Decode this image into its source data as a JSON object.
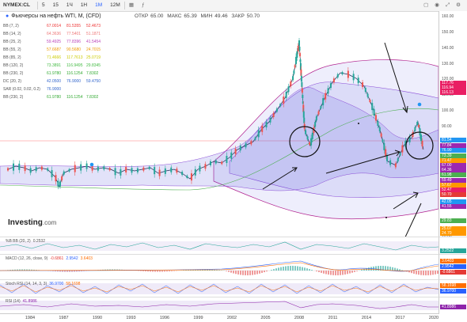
{
  "toolbar": {
    "symbol": "NYMEX:CL",
    "intervals": [
      "5",
      "15",
      "1Ч",
      "1Н",
      "1М",
      "12М"
    ],
    "active_interval": "1М",
    "icons": [
      "candles-icon",
      "indicators-icon",
      "layout-icon",
      "camera-icon",
      "fullscreen-icon",
      "settings-icon"
    ]
  },
  "header": {
    "title": "Фьючерсы на нефть WTI, M, (CFD)",
    "ohlc": [
      {
        "label": "ОТКР",
        "value": "65.00"
      },
      {
        "label": "МАКС",
        "value": "65.39"
      },
      {
        "label": "МИН",
        "value": "49.46"
      },
      {
        "label": "ЗАКР",
        "value": "50.70"
      }
    ]
  },
  "indicators": [
    {
      "name": "BB (7, 2)",
      "v1": "67.0014",
      "v2": "81.5355",
      "v3": "52.4673",
      "color": "#e33"
    },
    {
      "name": "BB (14, 2)",
      "v1": "64.3636",
      "v2": "77.5401",
      "v3": "51.1871",
      "color": "#e77"
    },
    {
      "name": "BB (25, 2)",
      "v1": "59.4925",
      "v2": "77.8396",
      "v3": "41.5454",
      "color": "#b4b"
    },
    {
      "name": "BB (55, 2)",
      "v1": "57.6687",
      "v2": "90.5680",
      "v3": "24.7015",
      "color": "#e90"
    },
    {
      "name": "BB (85, 2)",
      "v1": "71.4666",
      "v2": "117.7613",
      "v3": "25.0719",
      "color": "#cc0"
    },
    {
      "name": "BB (120, 2)",
      "v1": "73.3891",
      "v2": "116.9495",
      "v3": "29.8345",
      "color": "#4b4"
    },
    {
      "name": "BB (230, 2)",
      "v1": "61.9780",
      "v2": "116.1254",
      "v3": "7.8302",
      "color": "#3a3"
    },
    {
      "name": "DC (20, 2)",
      "v1": "42.0500",
      "v2": "76.9000",
      "v3": "59.4750",
      "color": "#36c"
    },
    {
      "name": "SAR (0.02, 0.02, 0.2)",
      "v1": "76.9000",
      "v2": "",
      "v3": "",
      "color": "#36c"
    },
    {
      "name": "BB (230, 2)",
      "v1": "61.9780",
      "v2": "116.1254",
      "v3": "7.8302",
      "color": "#3a3"
    }
  ],
  "price_axis": {
    "ticks": [
      "160.00",
      "150.00",
      "140.00",
      "130.00",
      "120.00",
      "110.00",
      "100.00",
      "90.00",
      "80.00",
      "70.00",
      "60.00",
      "50.00",
      "40.00",
      "30.00",
      "20.00"
    ],
    "tags": [
      {
        "value": "117.76",
        "color": "#e91e63"
      },
      {
        "value": "116.94",
        "color": "#e91e63"
      },
      {
        "value": "116.13",
        "color": "#e91e63"
      },
      {
        "value": "81.54",
        "color": "#2196f3"
      },
      {
        "value": "77.84",
        "color": "#9c27b0"
      },
      {
        "value": "76.90",
        "color": "#2196f3"
      },
      {
        "value": "73.39",
        "color": "#4caf50"
      },
      {
        "value": "71.47",
        "color": "#ff9800"
      },
      {
        "value": "67.00",
        "color": "#9c27b0"
      },
      {
        "value": "64.36",
        "color": "#9c27b0"
      },
      {
        "value": "61.98",
        "color": "#4caf50"
      },
      {
        "value": "59.49",
        "color": "#9c27b0"
      },
      {
        "value": "57.67",
        "color": "#ff9800"
      },
      {
        "value": "52.47",
        "color": "#e91e63"
      },
      {
        "value": "50.70",
        "color": "#e53935"
      },
      {
        "value": "42.05",
        "color": "#2196f3"
      },
      {
        "value": "41.55",
        "color": "#9c27b0"
      },
      {
        "value": "29.83",
        "color": "#4caf50"
      },
      {
        "value": "25.07",
        "color": "#ff9800"
      },
      {
        "value": "24.70",
        "color": "#ff9800"
      }
    ]
  },
  "logo": {
    "brand": "Investing",
    "suffix": ".com"
  },
  "panes": [
    {
      "name": "%B BB (20, 2)",
      "values": [
        "0.2532"
      ],
      "axis": [
        "3.2522"
      ]
    },
    {
      "name": "MACD (12, 26, close, 9)",
      "values": [
        "-0.6861",
        "2.9542",
        "3.6403"
      ],
      "axis": [
        "3.6403",
        "2.9542",
        "-0.6861"
      ]
    },
    {
      "name": "Stoch RSI (14, 14, 3, 3)",
      "values": [
        "36.9700",
        "58.1698"
      ],
      "axis": [
        "58.1698",
        "36.9700"
      ]
    },
    {
      "name": "RSI (14)",
      "values": [
        "41.8986"
      ],
      "axis": [
        "41.8986"
      ]
    }
  ],
  "time_axis": [
    "1984",
    "1987",
    "1990",
    "1993",
    "1996",
    "1999",
    "2002",
    "2005",
    "2008",
    "2011",
    "2014",
    "2017",
    "2020"
  ],
  "colors": {
    "accent": "#2962ff",
    "band_fill": "#5c5ce0",
    "band_line": "#b0208e",
    "up": "#26a69a",
    "down": "#ef5350"
  }
}
